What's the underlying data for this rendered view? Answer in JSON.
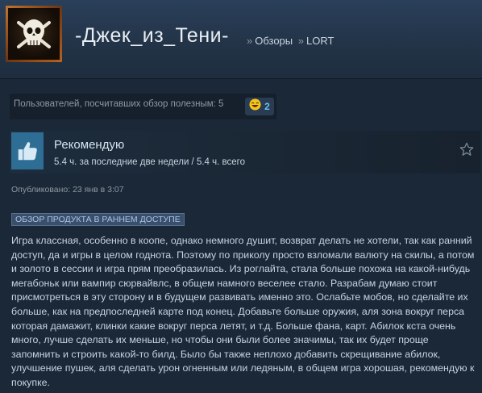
{
  "header": {
    "username": "-Джек_из_Тени-",
    "breadcrumb": [
      "Обзоры",
      "LORT"
    ],
    "separator": "»"
  },
  "helpful": {
    "text": "Пользователей, посчитавших обзор полезным: 5",
    "award_icon": "laughing-emoji-icon",
    "award_count": "2"
  },
  "review": {
    "verdict": "Рекомендую",
    "hours": "5.4 ч. за последние две недели / 5.4 ч. всего",
    "thumb_icon": "thumbs-up-icon",
    "posted": "Опубликовано: 23 янв в 3:07",
    "badge": "Обзор продукта в раннем доступе",
    "text": "Игра классная, особенно в коопе, однако немного душит, возврат делать не хотели, так как ранний доступ, да и игры в целом годнота. Поэтому по приколу просто взломали валюту на скилы, а потом и золото в сессии и игра прям преобразилась. Из роглайта, стала больше похожа на какой-нибудь мегабоньк или вампир сюрвайвлс, в общем намного веселее стало. Разрабам думаю стоит присмотреться в эту сторону и в будущем развивать именно это. Ослабьте мобов, но сделайте их больше, как на предпоследней карте под конец. Добавьте больше оружия, аля зона вокруг перса которая дамажит, клинки какие вокруг перса летят, и т.д. Больше фана, карт. Абилок кста очень много, лучше сделать их меньше, но чтобы они были более значимы, так их будет проще запомнить и строить какой-то билд. Было бы также неплохо добавить скрещивание абилок, улучшение пушек, аля сделать урон огненным или ледяным, в общем игра хорошая, рекомендую к покупке."
  },
  "colors": {
    "background": "#1b2838",
    "link": "#66c0f4",
    "badge_bg": "#3a4f6b"
  }
}
